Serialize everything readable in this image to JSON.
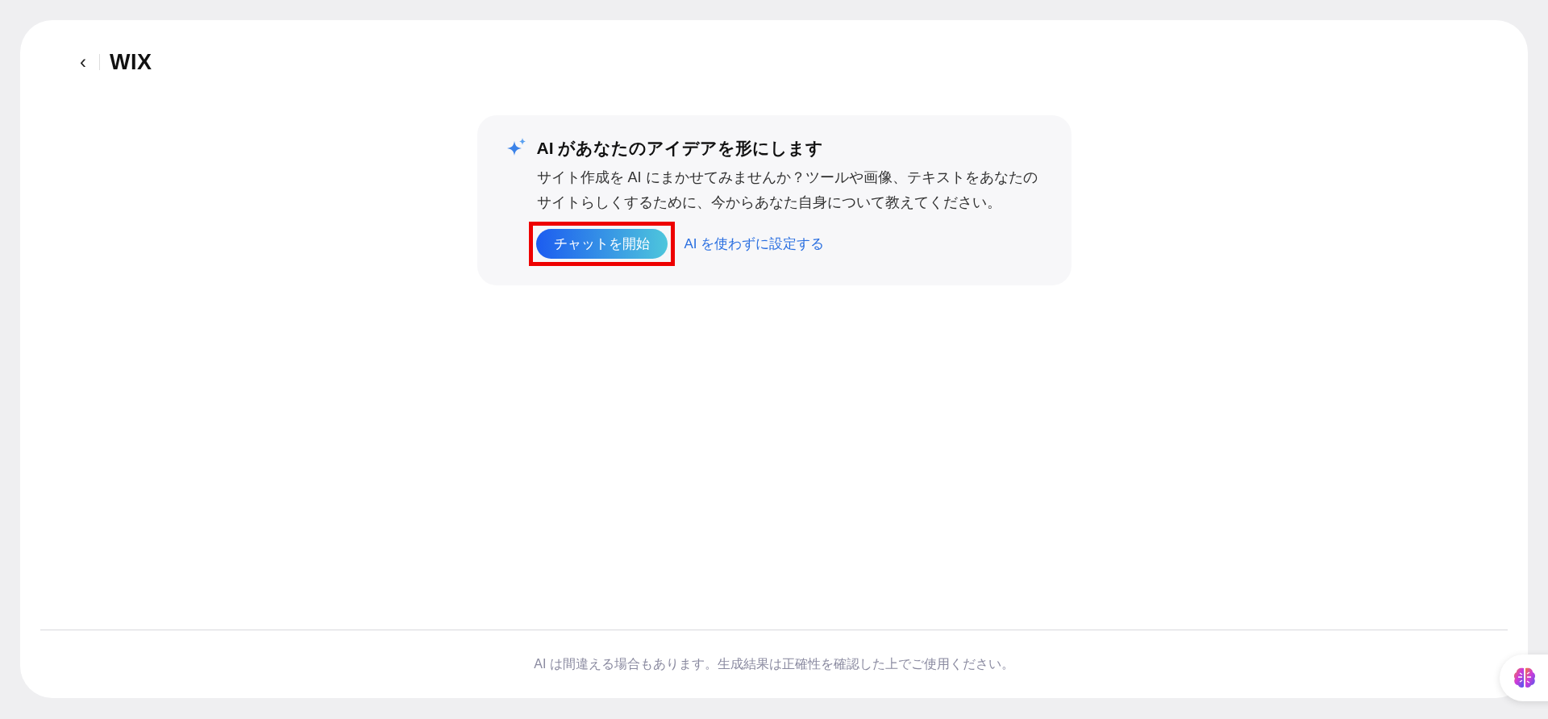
{
  "header": {
    "back_label": "‹",
    "logo": "WIX"
  },
  "card": {
    "title": "AI があなたのアイデアを形にします",
    "body": "サイト作成を AI にまかせてみませんか？ツールや画像、テキストをあなたのサイトらしくするために、今からあなた自身について教えてください。",
    "primary_button": {
      "label": "チャットを開始",
      "highlighted": true
    },
    "link": "AI を使わずに設定する"
  },
  "footer": {
    "disclaimer": "AI は間違える場合もあります。生成結果は正確性を確認した上でご使用ください。"
  }
}
